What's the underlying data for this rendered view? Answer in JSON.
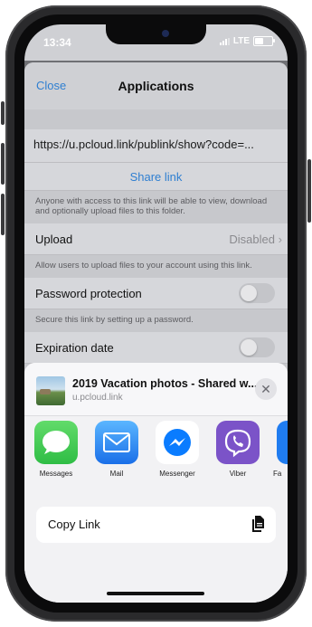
{
  "status": {
    "time": "13:34",
    "network": "LTE"
  },
  "nav": {
    "close_label": "Close",
    "title": "Applications"
  },
  "link": {
    "url": "https://u.pcloud.link/publink/show?code=...",
    "share_label": "Share link",
    "share_note": "Anyone with access to this link will be able to view, download and optionally upload files to this folder."
  },
  "upload": {
    "label": "Upload",
    "value": "Disabled",
    "note": "Allow users to upload files to your account using this link."
  },
  "password": {
    "label": "Password protection",
    "enabled": false,
    "note": "Secure this link by setting up a password."
  },
  "expiration": {
    "label": "Expiration date",
    "enabled": false
  },
  "share_sheet": {
    "title": "2019 Vacation photos - Shared w...",
    "subtitle": "u.pcloud.link",
    "apps": [
      {
        "label": "Messages",
        "icon": "messages-icon"
      },
      {
        "label": "Mail",
        "icon": "mail-icon"
      },
      {
        "label": "Messenger",
        "icon": "messenger-icon"
      },
      {
        "label": "Viber",
        "icon": "viber-icon"
      },
      {
        "label": "Fa",
        "icon": "app-icon"
      }
    ],
    "copy_label": "Copy Link"
  },
  "colors": {
    "accent": "#2f7fd1",
    "messages": "#34c759",
    "mail": "#1a7ef0",
    "messenger": "#0a7cff",
    "viber": "#7b53c8"
  }
}
